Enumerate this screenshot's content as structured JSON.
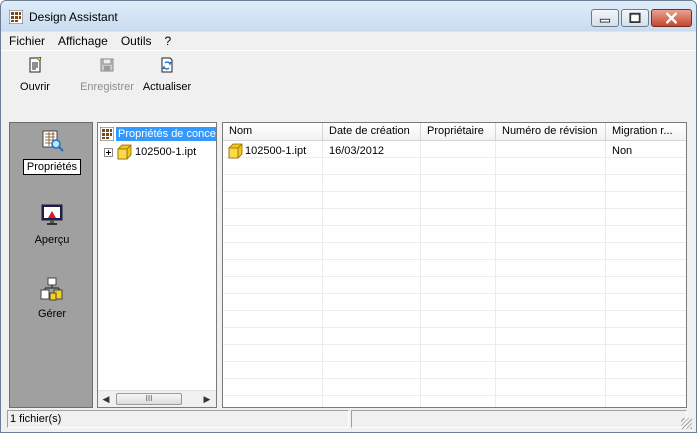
{
  "window": {
    "title": "Design Assistant",
    "icon": "design-assistant-icon",
    "controls": [
      "minimize",
      "maximize",
      "close"
    ]
  },
  "menubar": {
    "items": [
      {
        "label": "Fichier"
      },
      {
        "label": "Affichage"
      },
      {
        "label": "Outils"
      },
      {
        "label": "?"
      }
    ]
  },
  "toolbar": {
    "open_label": "Ouvrir",
    "save_label": "Enregistrer",
    "refresh_label": "Actualiser",
    "save_enabled": false
  },
  "nav": {
    "items": [
      {
        "label": "Propriétés",
        "icon": "properties-icon",
        "active": true
      },
      {
        "label": "Aperçu",
        "icon": "preview-icon",
        "active": false
      },
      {
        "label": "Gérer",
        "icon": "manage-icon",
        "active": false
      }
    ]
  },
  "tree": {
    "root_label": "Propriétés de conce",
    "child_label": "102500-1.ipt",
    "scroll_thumb": "III"
  },
  "list": {
    "columns": [
      "Nom",
      "Date de création",
      "Propriétaire",
      "Numéro de révision",
      "Migration r..."
    ],
    "rows": [
      {
        "name": "102500-1.ipt",
        "created": "16/03/2012",
        "owner": "",
        "revision": "",
        "migration": "Non"
      }
    ]
  },
  "status": {
    "file_count": "1 fichier(s)",
    "secondary": ""
  },
  "colors": {
    "selection": "#3399ff",
    "nav_background": "#a0a0a0",
    "close_button": "#c5472f"
  }
}
